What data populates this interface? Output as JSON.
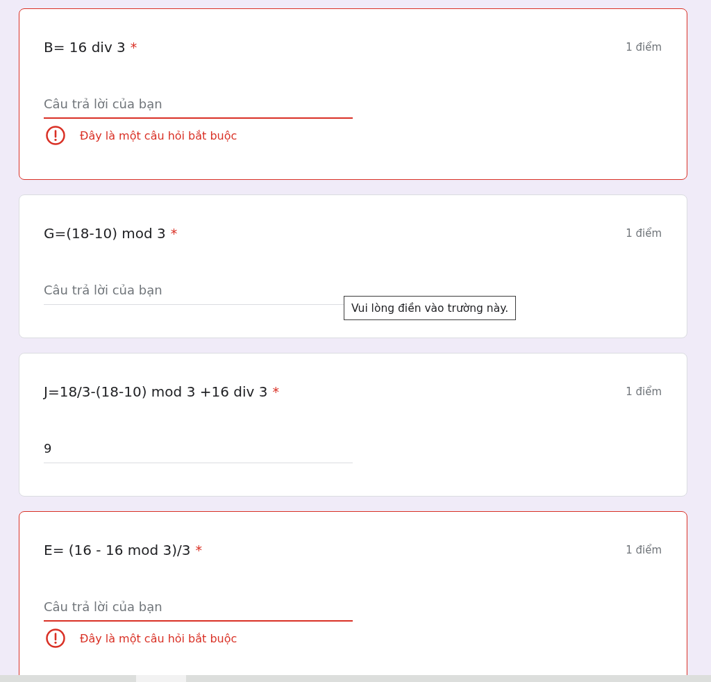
{
  "questions": [
    {
      "title": "B= 16 div 3",
      "required_mark": "*",
      "points": "1 điểm",
      "invalid": true,
      "answer": {
        "placeholder": "Câu trả lời của bạn"
      },
      "error": "Đây là một câu hỏi bắt buộc"
    },
    {
      "title": "G=(18-10) mod 3",
      "required_mark": "*",
      "points": "1 điểm",
      "invalid": false,
      "answer": {
        "placeholder": "Câu trả lời của bạn",
        "tooltip": "Vui lòng điền vào trường này."
      }
    },
    {
      "title": "J=18/3-(18-10) mod 3 +16 div 3",
      "required_mark": "*",
      "points": "1 điểm",
      "invalid": false,
      "answer": {
        "value": "9"
      }
    },
    {
      "title": "E= (16 - 16 mod 3)/3",
      "required_mark": "*",
      "points": "1 điểm",
      "invalid": true,
      "answer": {
        "placeholder": "Câu trả lời của bạn"
      },
      "error": "Đây là một câu hỏi bắt buộc"
    }
  ]
}
